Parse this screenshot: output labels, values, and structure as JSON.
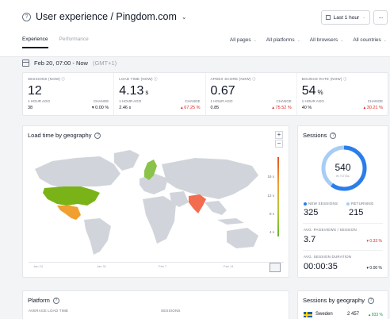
{
  "header": {
    "title": "User experience / Pingdom.com",
    "time_range": "Last 1 hour",
    "more": "···",
    "tabs": [
      {
        "label": "Experience",
        "active": true
      },
      {
        "label": "Performance",
        "active": false
      }
    ],
    "filters": [
      "All pages",
      "All platforms",
      "All browsers",
      "All countries"
    ]
  },
  "date": {
    "range": "Feb 20, 07:00 - Now",
    "timezone": "(GMT+1)"
  },
  "metrics": [
    {
      "label": "SESSIONS (NOW)",
      "value": "12",
      "unit": "",
      "ago_label": "1 HOUR AGO",
      "ago_value": "38",
      "change_label": "CHANGE",
      "change_value": "▾ 0.00 %",
      "change_color": "#111827"
    },
    {
      "label": "LOAD TIME (NOW)",
      "value": "4.13",
      "unit": "s",
      "ago_label": "1 HOUR AGO",
      "ago_value": "2.46 s",
      "change_label": "CHANGE",
      "change_value": "▴ 67.25 %",
      "change_color": "#dc2626"
    },
    {
      "label": "APDEX SCORE (NOW)",
      "value": "0.67",
      "unit": "",
      "ago_label": "1 HOUR AGO",
      "ago_value": "0.85",
      "change_label": "CHANGE",
      "change_value": "▴ 75.52 %",
      "change_color": "#dc2626"
    },
    {
      "label": "BOUNCE RATE (NOW)",
      "value": "54",
      "unit": "%",
      "ago_label": "1 HOUR AGO",
      "ago_value": "40 %",
      "change_label": "CHANGE",
      "change_value": "▴ 30.21 %",
      "change_color": "#dc2626"
    }
  ],
  "map": {
    "title": "Load time by geography",
    "zoom_in": "+",
    "zoom_out": "−",
    "legend": [
      "16 s",
      "12 s",
      "8 s",
      "4 s"
    ],
    "timeline_labels": [
      "Jan 24",
      "Jan 31",
      "Feb 7",
      "Feb 14"
    ],
    "colors": {
      "land": "#d1d5db",
      "usa": "#7ab317",
      "mexico": "#f0a030",
      "sweden": "#8bc34a",
      "india": "#f26d4f"
    }
  },
  "sessions": {
    "title": "Sessions",
    "total": "540",
    "total_label": "IN TOTAL",
    "new_label": "NEW SESSIONS",
    "new_value": "325",
    "returning_label": "RETURNING",
    "returning_value": "215",
    "pv_label": "AVG. PAGEVIEWS / SESSION",
    "pv_value": "3.7",
    "pv_change": "▾ 0.33 %",
    "dur_label": "AVG. SESSION DURATION",
    "dur_value": "00:00:35",
    "dur_change": "▾ 0.00 %",
    "new_fraction": 0.6,
    "colors": {
      "new": "#2b7de9",
      "returning": "#a8cdf5"
    }
  },
  "platform": {
    "title": "Platform",
    "col1": "AVERAGE LOAD TIME",
    "col2": "SESSIONS"
  },
  "geo": {
    "title": "Sessions by geography",
    "country": "Sweden",
    "value": "2 457",
    "change": "▴ 833 %"
  }
}
